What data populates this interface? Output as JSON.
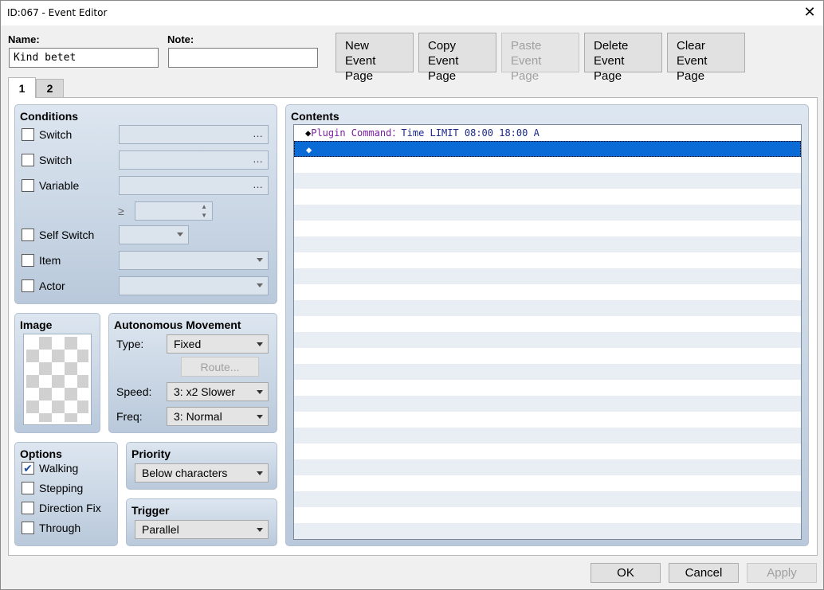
{
  "window": {
    "title": "ID:067 - Event Editor"
  },
  "header": {
    "name_label": "Name:",
    "name_value": "Kind betet",
    "note_label": "Note:",
    "note_value": "",
    "buttons": {
      "new": [
        "New",
        "Event Page"
      ],
      "copy": [
        "Copy",
        "Event Page"
      ],
      "paste": [
        "Paste",
        "Event Page"
      ],
      "delete": [
        "Delete",
        "Event Page"
      ],
      "clear": [
        "Clear",
        "Event Page"
      ]
    }
  },
  "tabs": [
    "1",
    "2"
  ],
  "conditions": {
    "title": "Conditions",
    "switch1": "Switch",
    "switch2": "Switch",
    "variable": "Variable",
    "gte": "≥",
    "self_switch": "Self Switch",
    "item": "Item",
    "actor": "Actor",
    "dots": "…"
  },
  "image": {
    "title": "Image"
  },
  "movement": {
    "title": "Autonomous Movement",
    "type_label": "Type:",
    "type_value": "Fixed",
    "route_button": "Route...",
    "speed_label": "Speed:",
    "speed_value": "3: x2 Slower",
    "freq_label": "Freq:",
    "freq_value": "3: Normal"
  },
  "options": {
    "title": "Options",
    "walking": "Walking",
    "stepping": "Stepping",
    "direction_fix": "Direction Fix",
    "through": "Through",
    "checked": {
      "walking": true,
      "stepping": false,
      "direction_fix": false,
      "through": false
    }
  },
  "priority": {
    "title": "Priority",
    "value": "Below characters"
  },
  "trigger": {
    "title": "Trigger",
    "value": "Parallel"
  },
  "contents": {
    "title": "Contents",
    "commands": [
      {
        "marker": "◆",
        "name": "Plugin Command",
        "sep": "：",
        "args": "Time LIMIT 08:00 18:00 A"
      },
      {
        "marker": "◆",
        "name": "",
        "sep": "",
        "args": ""
      }
    ]
  },
  "footer": {
    "ok": "OK",
    "cancel": "Cancel",
    "apply": "Apply"
  },
  "colors": {
    "selection": "#0a6bd6",
    "command": "#7a1fa2",
    "argument": "#1c2a8a"
  }
}
